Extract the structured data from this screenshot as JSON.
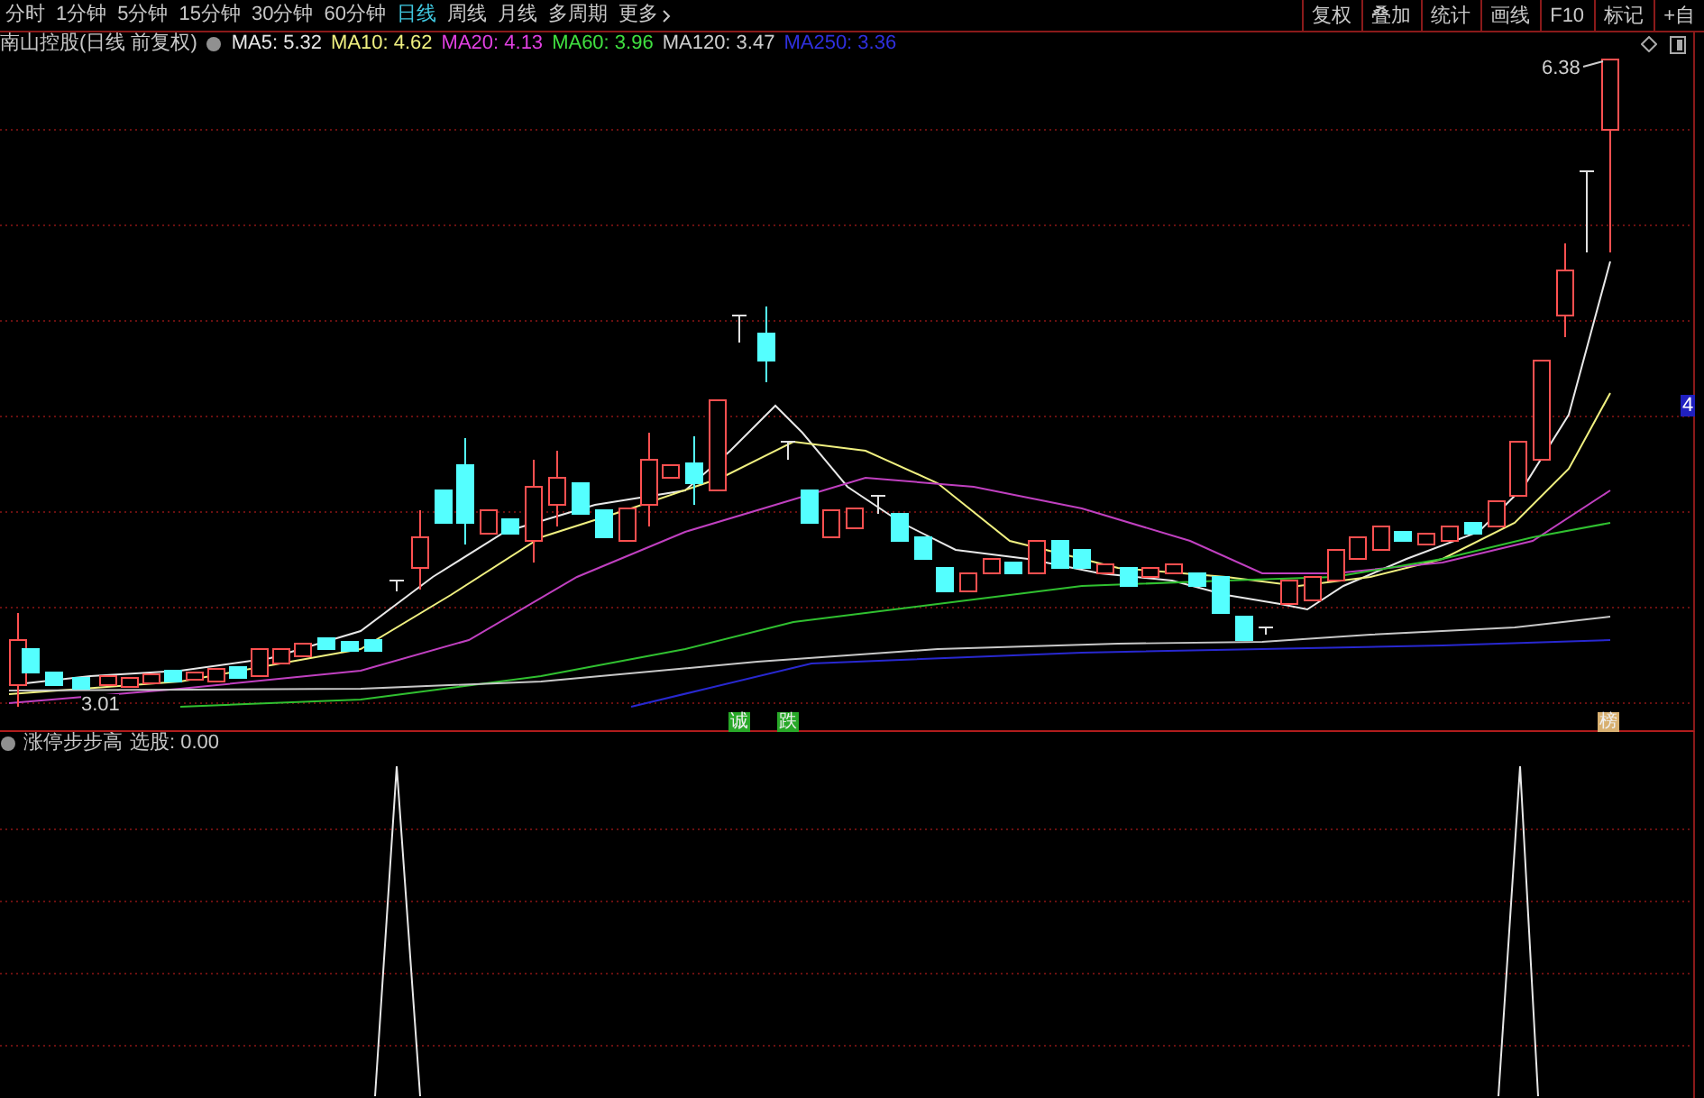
{
  "timeframe_tabs": [
    {
      "label": "分时",
      "selected": false
    },
    {
      "label": "1分钟",
      "selected": false
    },
    {
      "label": "5分钟",
      "selected": false
    },
    {
      "label": "15分钟",
      "selected": false
    },
    {
      "label": "30分钟",
      "selected": false
    },
    {
      "label": "60分钟",
      "selected": false
    },
    {
      "label": "日线",
      "selected": true
    },
    {
      "label": "周线",
      "selected": false
    },
    {
      "label": "月线",
      "selected": false
    },
    {
      "label": "多周期",
      "selected": false
    },
    {
      "label": "更多",
      "selected": false
    }
  ],
  "toolbar_buttons": [
    "复权",
    "叠加",
    "统计",
    "画线",
    "F10",
    "标记",
    "+自"
  ],
  "stock_title": "南山控股(日线 前复权)",
  "ma_legend": [
    {
      "label": "MA5: 5.32",
      "color": "#e8e8e8"
    },
    {
      "label": "MA10: 4.62",
      "color": "#f0f080"
    },
    {
      "label": "MA20: 4.13",
      "color": "#e040e0"
    },
    {
      "label": "MA60: 3.96",
      "color": "#40e040"
    },
    {
      "label": "MA120: 3.47",
      "color": "#d0d0d0"
    },
    {
      "label": "MA250: 3.36",
      "color": "#3030e0"
    }
  ],
  "price_labels": {
    "high": "6.38",
    "low": "3.01"
  },
  "axis_label": "4",
  "signals": [
    {
      "label": "诚",
      "color": "#28a828"
    },
    {
      "label": "跌",
      "color": "#28a828"
    },
    {
      "label": "榜",
      "color": "#d8b070"
    }
  ],
  "indicator": {
    "name": "涨停步步高",
    "reading": "选股: 0.00"
  }
}
